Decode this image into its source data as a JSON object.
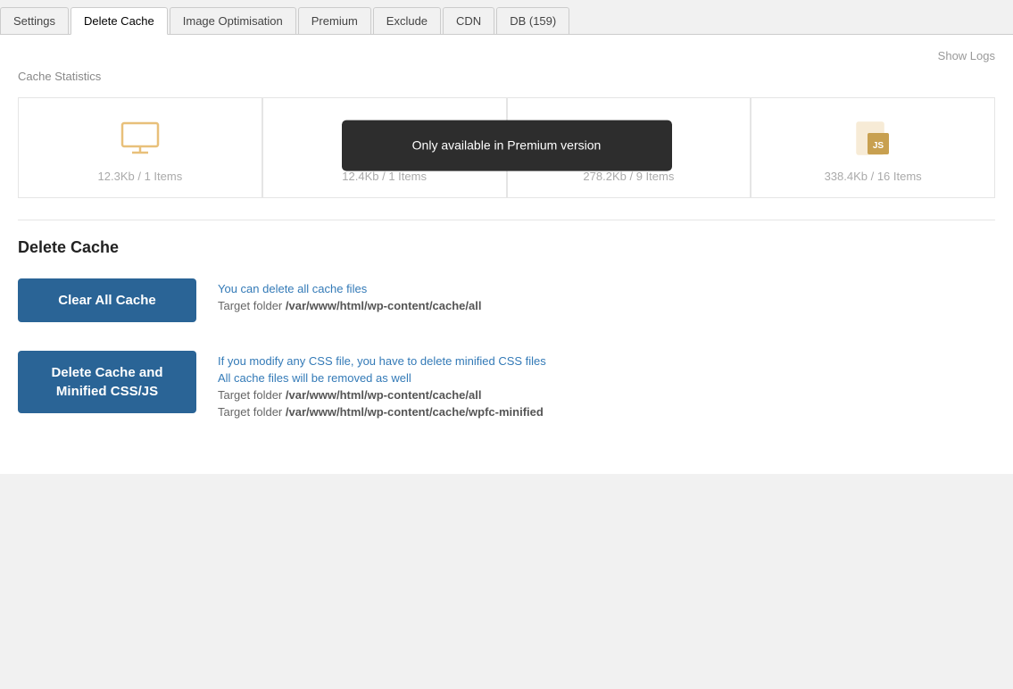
{
  "tabs": [
    {
      "label": "Settings",
      "active": false
    },
    {
      "label": "Delete Cache",
      "active": true
    },
    {
      "label": "Image Optimisation",
      "active": false
    },
    {
      "label": "Premium",
      "active": false
    },
    {
      "label": "Exclude",
      "active": false
    },
    {
      "label": "CDN",
      "active": false
    },
    {
      "label": "DB (159)",
      "active": false
    }
  ],
  "header": {
    "show_logs": "Show Logs"
  },
  "cache_statistics": {
    "title": "Cache Statistics",
    "stats": [
      {
        "value": "12.3Kb / 1 Items",
        "icon": "monitor"
      },
      {
        "value": "12.4Kb / 1 Items",
        "icon": "tablet"
      },
      {
        "value": "278.2Kb / 9 Items",
        "icon": "css"
      },
      {
        "value": "338.4Kb / 16 Items",
        "icon": "js"
      }
    ],
    "tooltip": {
      "text": "Only available in Premium version"
    }
  },
  "delete_cache": {
    "title": "Delete Cache",
    "actions": [
      {
        "button_label": "Clear All Cache",
        "info_lines": [
          {
            "text": "You can delete all cache files",
            "type": "link"
          },
          {
            "prefix": "Target folder ",
            "path": "/var/www/html/wp-content/cache/all",
            "type": "path"
          }
        ]
      },
      {
        "button_label": "Delete Cache and\nMinified CSS/JS",
        "info_lines": [
          {
            "text": "If you modify any CSS file, you have to delete minified CSS files",
            "type": "link"
          },
          {
            "text": "All cache files will be removed as well",
            "type": "link"
          },
          {
            "prefix": "Target folder ",
            "path": "/var/www/html/wp-content/cache/all",
            "type": "path"
          },
          {
            "prefix": "Target folder ",
            "path": "/var/www/html/wp-content/cache/wpfc-minified",
            "type": "path"
          }
        ]
      }
    ]
  }
}
